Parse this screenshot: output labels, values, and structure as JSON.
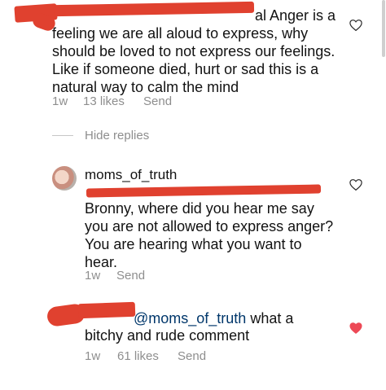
{
  "comment1": {
    "text_line1": "al Anger is a",
    "text_line2": "feeling we are all aloud to express, why",
    "text_line3": "should be loved to not express our feelings.",
    "text_line4": "Like if someone died, hurt or sad this is a",
    "text_line5": "natural way to calm the mind",
    "time": "1w",
    "likes": "13 likes",
    "send": "Send"
  },
  "hide_replies": "Hide replies",
  "reply1": {
    "username": "moms_of_truth",
    "text_line1": "Bronny, where did you hear me say",
    "text_line2": "you are not allowed to express anger?",
    "text_line3": "You are hearing what you want to",
    "text_line4": "hear.",
    "time": "1w",
    "send": "Send"
  },
  "reply2": {
    "mention": "@moms_of_truth",
    "text_after_mention": " what a",
    "text_line2": "bitchy and rude comment",
    "time": "1w",
    "likes": "61 likes",
    "send": "Send",
    "liked_color": "#ed4956"
  },
  "icons": {
    "like_outline": "heart-outline-icon",
    "like_filled": "heart-filled-icon"
  }
}
